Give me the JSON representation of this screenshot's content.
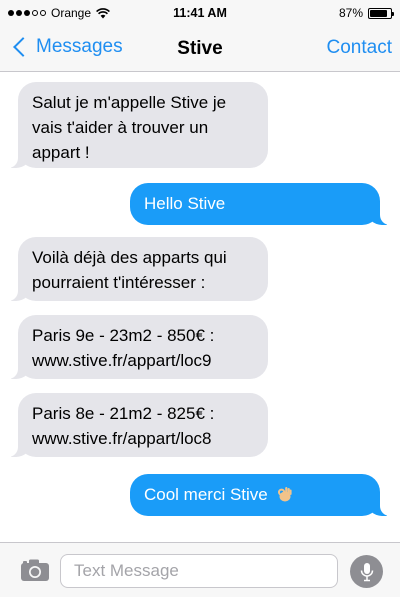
{
  "status_bar": {
    "carrier": "Orange",
    "time": "11:41 AM",
    "battery": "87%",
    "battery_level": 0.87,
    "signal_bars_filled": 3,
    "signal_bars_total": 5,
    "wifi_icon": "wifi-icon"
  },
  "nav": {
    "back_label": "Messages",
    "title": "Stive",
    "contact_label": "Contact",
    "accent_color": "#1f8ef1"
  },
  "messages": [
    {
      "direction": "received",
      "text": "Salut je m'appelle Stive je vais t'aider à trouver un appart !"
    },
    {
      "direction": "sent",
      "text": "Hello Stive"
    },
    {
      "direction": "received",
      "text": "Voilà déjà des apparts qui pourraient t'intéresser :"
    },
    {
      "direction": "received",
      "text": "Paris 9e - 23m2 - 850€ : www.stive.fr/appart/loc9"
    },
    {
      "direction": "received",
      "text": "Paris 8e - 21m2 - 825€ : www.stive.fr/appart/loc8"
    },
    {
      "direction": "sent",
      "text": "Cool merci Stive",
      "emoji_icon": "ok-hand-icon"
    }
  ],
  "colors": {
    "received_bubble": "#e5e5ea",
    "sent_bubble": "#1a9cf8"
  },
  "input_bar": {
    "placeholder": "Text Message",
    "value": "",
    "camera_icon": "camera-icon",
    "mic_icon": "microphone-icon"
  }
}
